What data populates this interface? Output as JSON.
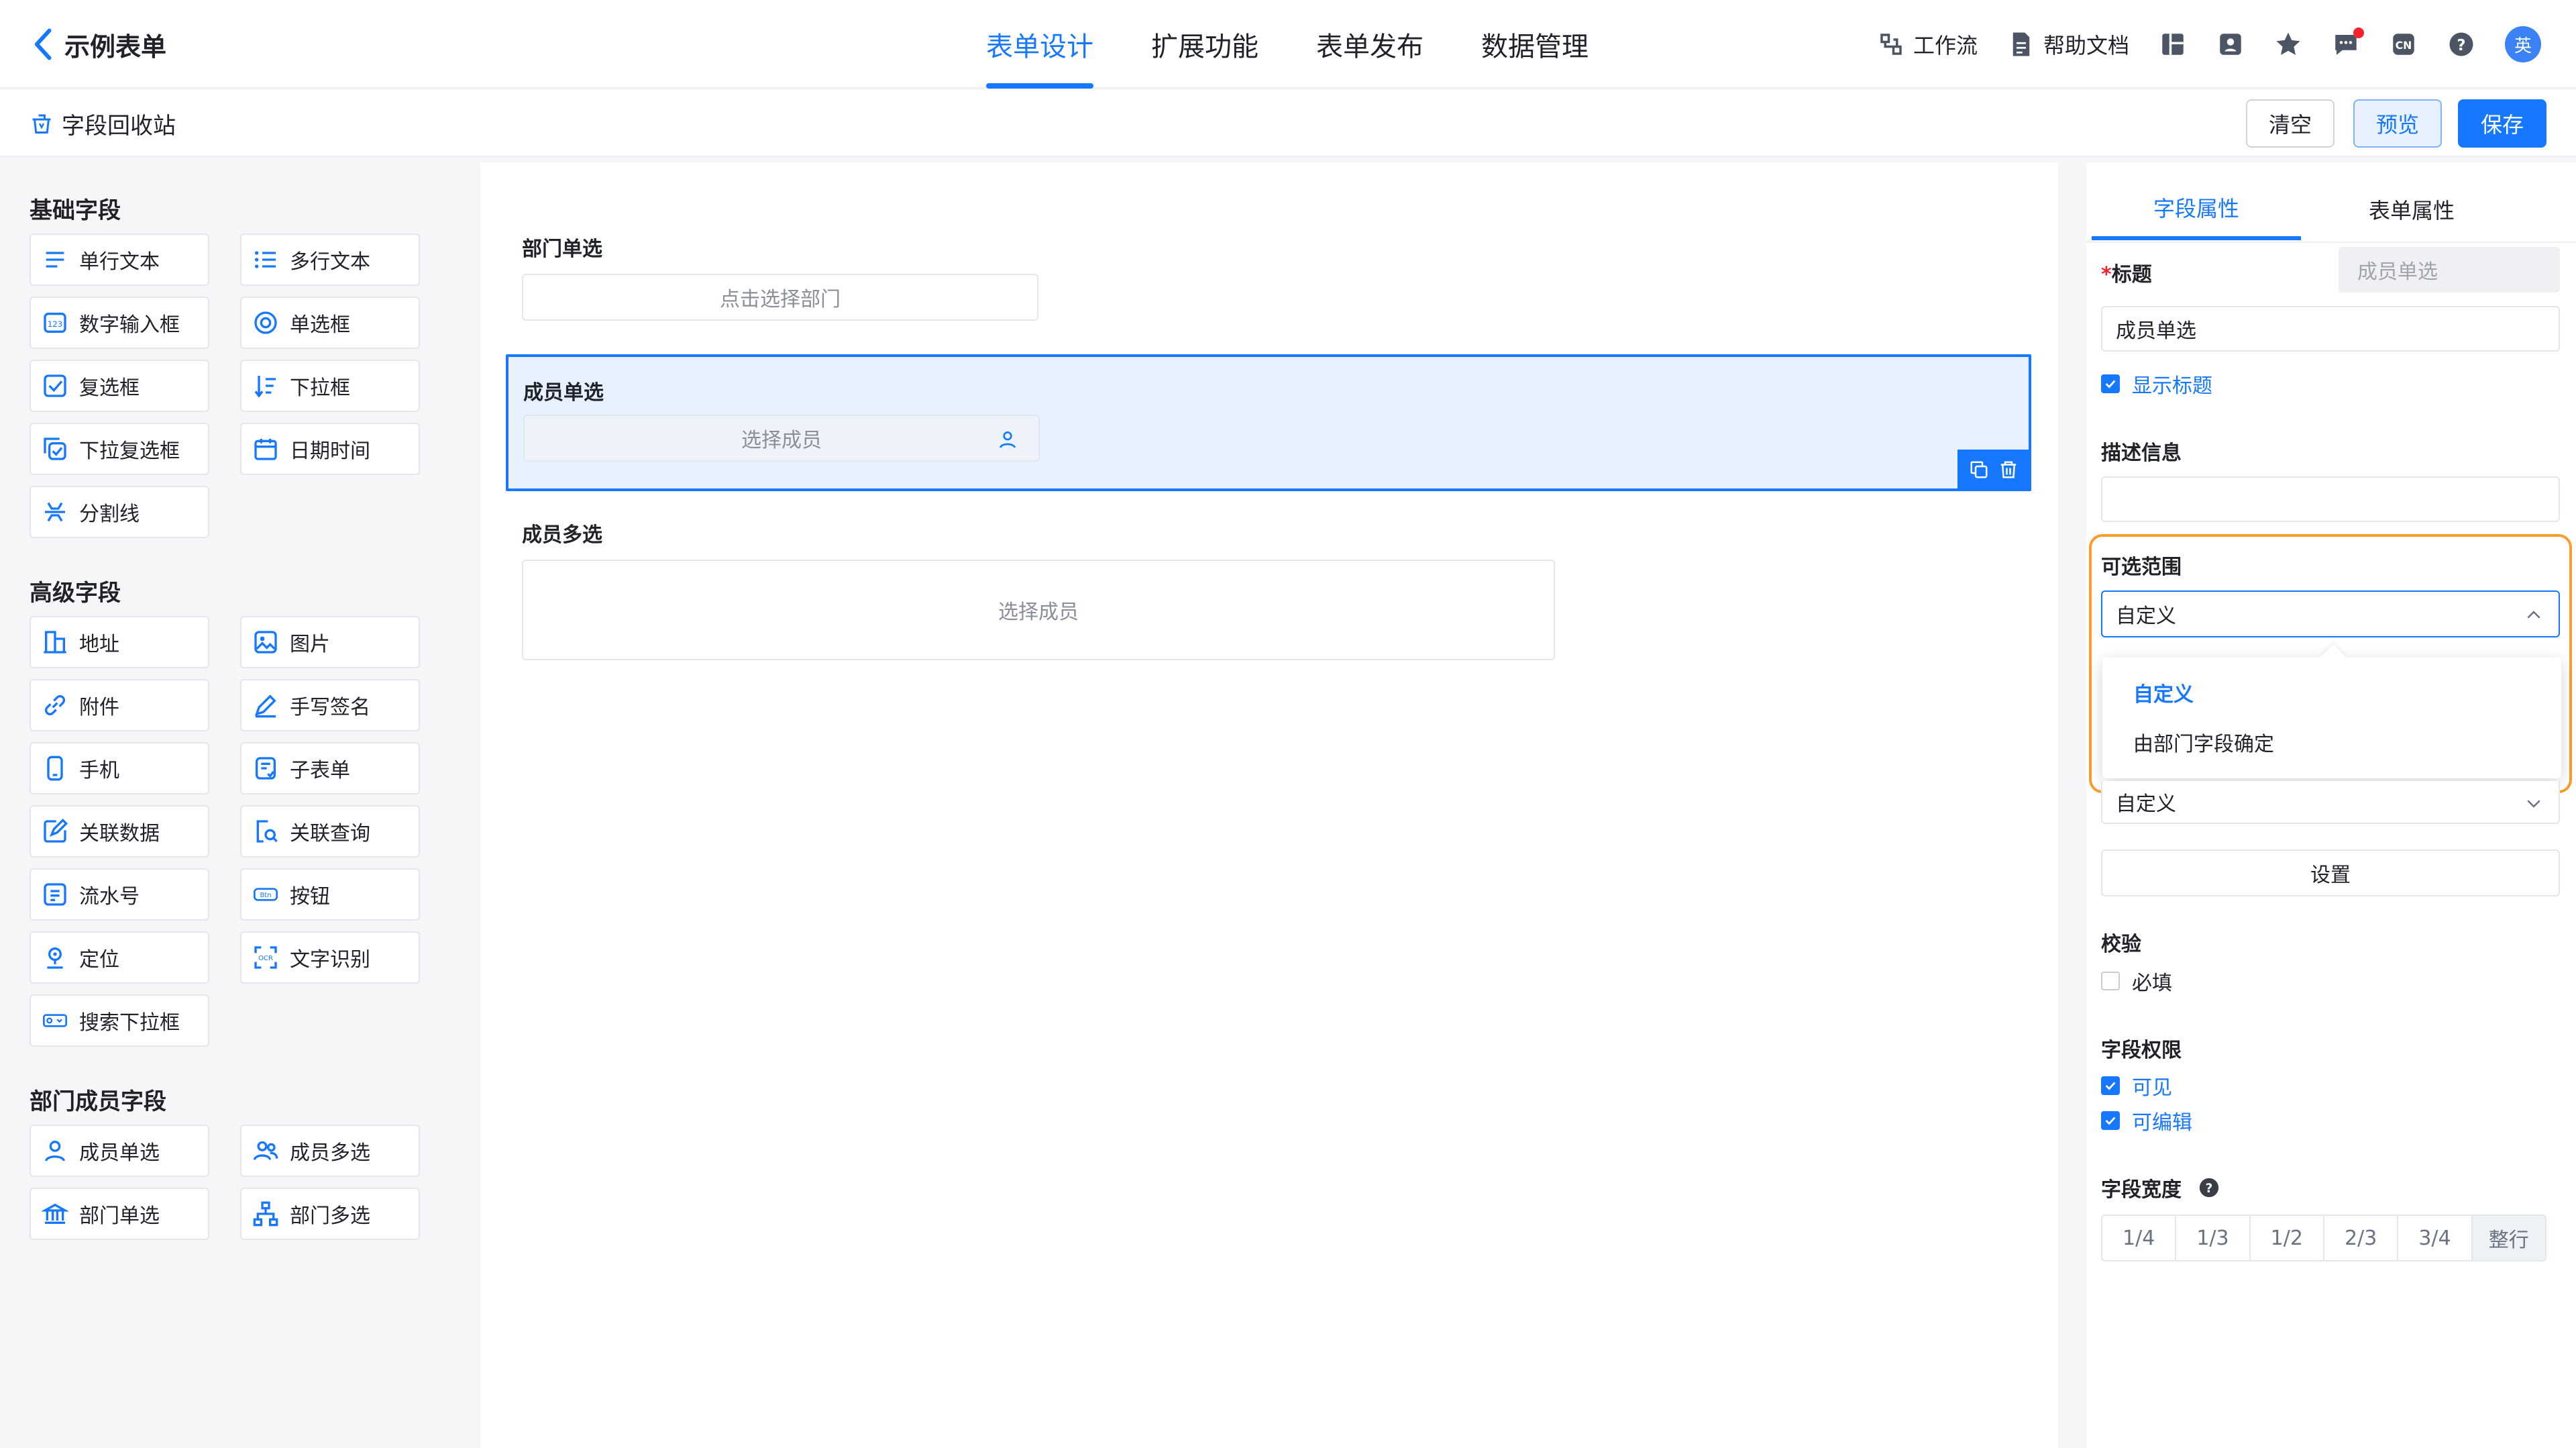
{
  "header": {
    "back_label": "示例表单",
    "tabs": [
      {
        "label": "表单设计",
        "active": true
      },
      {
        "label": "扩展功能",
        "active": false
      },
      {
        "label": "表单发布",
        "active": false
      },
      {
        "label": "数据管理",
        "active": false
      }
    ],
    "tools": {
      "workflow": "工作流",
      "help_docs": "帮助文档",
      "avatar": "英"
    }
  },
  "subbar": {
    "recycle": "字段回收站",
    "clear": "清空",
    "preview": "预览",
    "save": "保存"
  },
  "left": {
    "groups": [
      {
        "title": "基础字段",
        "items": [
          "单行文本",
          "多行文本",
          "数字输入框",
          "单选框",
          "复选框",
          "下拉框",
          "下拉复选框",
          "日期时间",
          "分割线"
        ]
      },
      {
        "title": "高级字段",
        "items": [
          "地址",
          "图片",
          "附件",
          "手写签名",
          "手机",
          "子表单",
          "关联数据",
          "关联查询",
          "流水号",
          "按钮",
          "定位",
          "文字识别",
          "搜索下拉框"
        ]
      },
      {
        "title": "部门成员字段",
        "items": [
          "成员单选",
          "成员多选",
          "部门单选",
          "部门多选"
        ]
      }
    ]
  },
  "canvas": {
    "fields": [
      {
        "label": "部门单选",
        "placeholder": "点击选择部门"
      },
      {
        "label": "成员单选",
        "placeholder": "选择成员"
      },
      {
        "label": "成员多选",
        "placeholder": "选择成员"
      }
    ]
  },
  "right": {
    "tabs": [
      "字段属性",
      "表单属性"
    ],
    "title_label": "标题",
    "title_hint": "成员单选",
    "title_value": "成员单选",
    "show_title": "显示标题",
    "desc_label": "描述信息",
    "desc_value": "",
    "range_label": "可选范围",
    "range_value": "自定义",
    "range_options": [
      "自定义",
      "由部门字段确定"
    ],
    "default_value": "自定义",
    "setting_button": "设置",
    "validate_label": "校验",
    "required": "必填",
    "perm_label": "字段权限",
    "visible": "可见",
    "editable": "可编辑",
    "width_label": "字段宽度",
    "width_options": [
      "1/4",
      "1/3",
      "1/2",
      "2/3",
      "3/4",
      "整行"
    ],
    "width_selected": "整行"
  },
  "colors": {
    "accent": "#1677ff",
    "highlight": "#fa9d2b"
  }
}
